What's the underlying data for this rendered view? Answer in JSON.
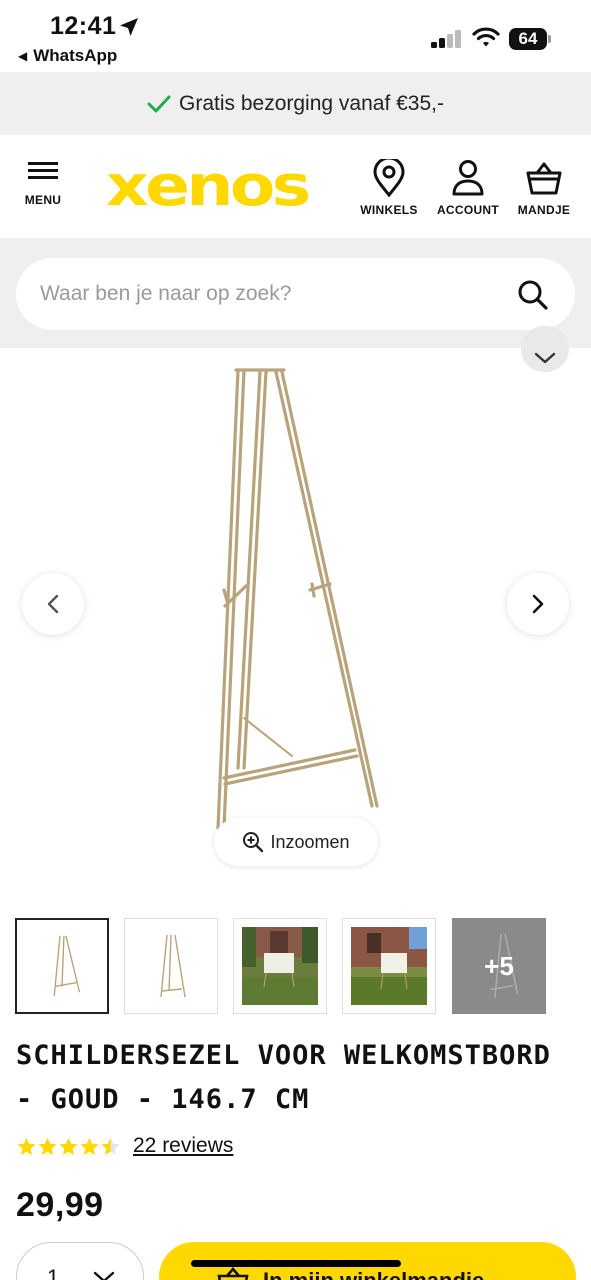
{
  "status_bar": {
    "time": "12:41",
    "back_app": "WhatsApp",
    "battery": "64"
  },
  "promo": {
    "text": "Gratis bezorging vanaf €35,-",
    "accent": "#1bb04a"
  },
  "header": {
    "menu_label": "MENU",
    "logo": "xenos",
    "stores_label": "WINKELS",
    "account_label": "ACCOUNT",
    "cart_label": "MANDJE",
    "brand_color": "#ffd800"
  },
  "search": {
    "placeholder": "Waar ben je naar op zoek?"
  },
  "gallery": {
    "zoom_label": "Inzoomen"
  },
  "thumbnails": {
    "more_label": "+5"
  },
  "product": {
    "title": "SCHILDERSEZEL VOOR WELKOMSTBORD - GOUD - 146.7 CM",
    "rating": 4.5,
    "rating_max": 5,
    "reviews_label": "22 reviews",
    "price": "29,99"
  },
  "purchase": {
    "quantity": "1",
    "add_to_cart_label": "In mijn winkelmandje"
  }
}
